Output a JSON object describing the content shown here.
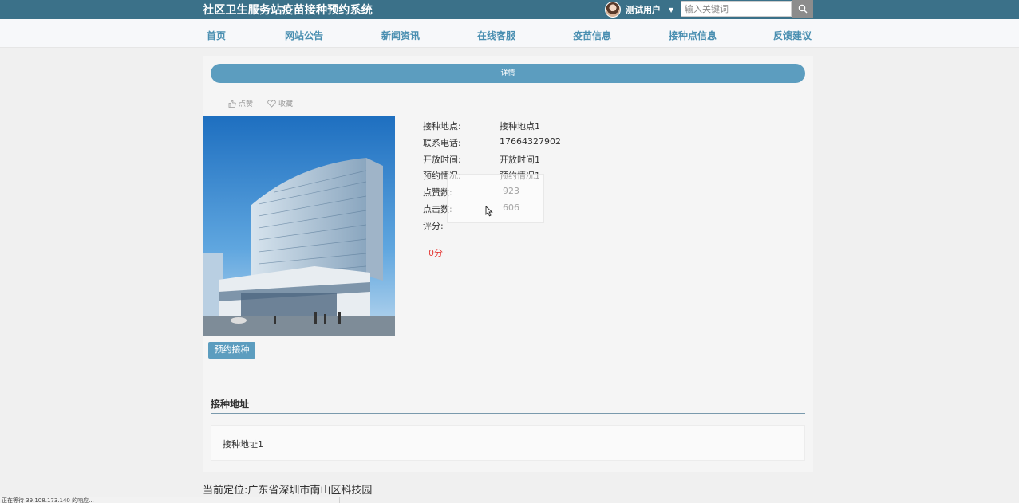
{
  "header": {
    "site_title": "社区卫生服务站疫苗接种预约系统",
    "user_name": "测试用户",
    "search_placeholder": "输入关键词"
  },
  "nav": {
    "items": [
      "首页",
      "网站公告",
      "新闻资讯",
      "在线客服",
      "疫苗信息",
      "接种点信息",
      "反馈建议"
    ]
  },
  "detail": {
    "bar_label": "详情",
    "like_label": "点赞",
    "favorite_label": "收藏",
    "fields": [
      {
        "label": "接种地点:",
        "value": "接种地点1"
      },
      {
        "label": "联系电话:",
        "value": "17664327902"
      },
      {
        "label": "开放时间:",
        "value": "开放时间1"
      },
      {
        "label": "预约情况:",
        "value": "预约情况1"
      },
      {
        "label": "点赞数:",
        "value": "923"
      },
      {
        "label": "点击数:",
        "value": "606"
      },
      {
        "label": "评分:",
        "value": ""
      }
    ],
    "score": "0分",
    "book_button": "预约接种"
  },
  "address_section": {
    "title": "接种地址",
    "content": "接种地址1"
  },
  "footer": {
    "location": "当前定位:广东省深圳市南山区科技园",
    "status_text": "正在等待 39.108.173.140 的响应..."
  },
  "colors": {
    "topbar": "#3b7189",
    "accent": "#5c9dbf",
    "nav_text": "#4a8fb1",
    "score": "#e53935"
  }
}
